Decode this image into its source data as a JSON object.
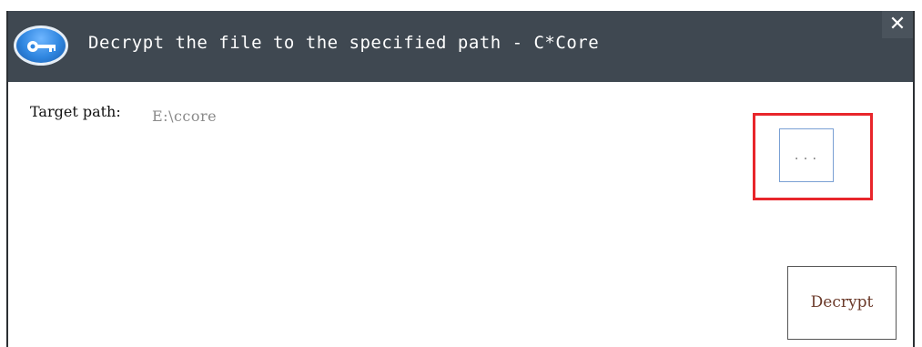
{
  "window": {
    "title": "Decrypt the file to the specified path - C*Core",
    "close_label": "✕",
    "app_icon": "key-icon"
  },
  "form": {
    "target_path_label": "Target path:",
    "target_path_value": "E:\\ccore",
    "browse_label": "...",
    "decrypt_label": "Decrypt"
  },
  "colors": {
    "titlebar": "#3f4851",
    "highlight": "#e8262b",
    "browse_border": "#7aa0d4"
  }
}
